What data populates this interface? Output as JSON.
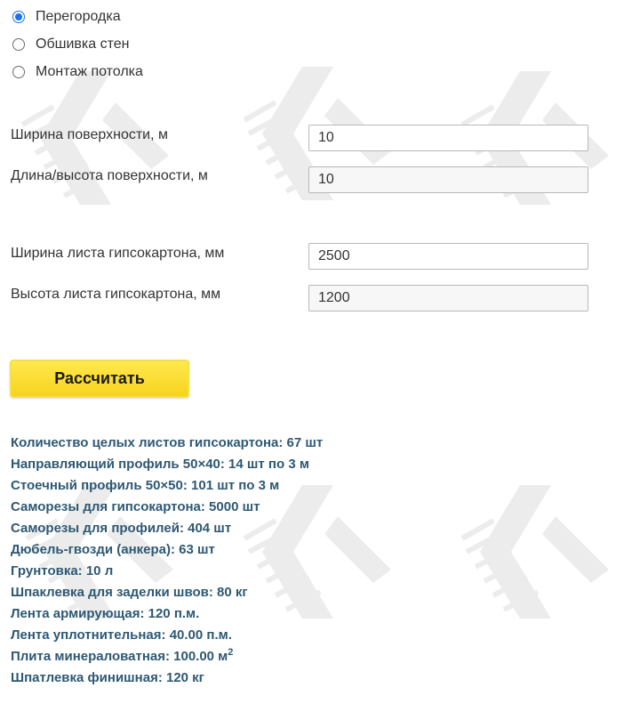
{
  "mode_options": [
    {
      "label": "Перегородка",
      "checked": true
    },
    {
      "label": "Обшивка стен",
      "checked": false
    },
    {
      "label": "Монтаж потолка",
      "checked": false
    }
  ],
  "surface": {
    "width_label": "Ширина поверхности, м",
    "width_value": "10",
    "length_label": "Длина/высота поверхности, м",
    "length_value": "10"
  },
  "sheet": {
    "width_label": "Ширина листа гипсокартона, мм",
    "width_value": "2500",
    "height_label": "Высота листа гипсокартона, мм",
    "height_value": "1200"
  },
  "calculate_button_label": "Рассчитать",
  "results": [
    "Количество целых листов гипсокартона: 67 шт",
    "Направляющий профиль 50×40: 14 шт по 3 м",
    "Стоечный профиль 50×50: 101 шт по 3 м",
    "Саморезы для гипсокартона: 5000 шт",
    "Саморезы для профилей: 404 шт",
    "Дюбель-гвозди (анкера): 63 шт",
    "Грунтовка: 10 л",
    "Шпаклевка для заделки швов: 80 кг",
    "Лента армирующая: 120 п.м.",
    "Лента уплотнительная: 40.00 п.м.",
    "Плита минераловатная: 100.00 м",
    "Шпатлевка финишная: 120 кг"
  ],
  "area_unit_superscript": "2",
  "colors": {
    "accent_radio": "#1a73e8",
    "button_yellow": "#f8d21e",
    "result_text": "#2e5873",
    "watermark": "#ececec"
  },
  "icons": [
    "watermark-logo-icon"
  ]
}
